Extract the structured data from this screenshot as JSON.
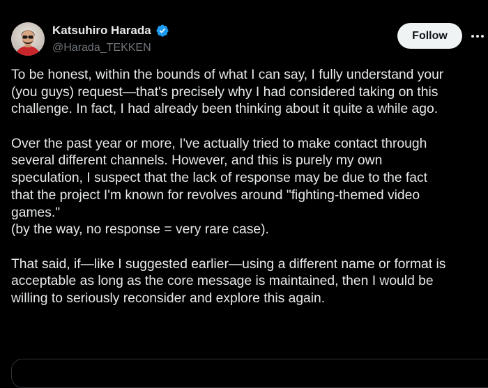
{
  "author": {
    "name": "Katsuhiro Harada",
    "handle": "@Harada_TEKKEN",
    "verified_icon": "verified-badge-icon",
    "verified_color": "#1d9bf0"
  },
  "actions": {
    "follow_label": "Follow",
    "more_icon": "more-options-icon"
  },
  "tweet": {
    "paragraphs": [
      [
        "To be honest, within the bounds of what I can say, I fully understand your",
        "(you guys) request—that's precisely why I had considered taking on this",
        "challenge. In fact, I had already been thinking about it quite a while ago."
      ],
      [
        "Over the past year or more, I've actually tried to make contact through",
        "several different channels. However, and this is purely my own",
        "speculation, I suspect that the lack of response may be due to the fact",
        "that the project I'm known for revolves around \"fighting-themed video",
        "games.\"",
        "(by the way, no response = very rare case)."
      ],
      [
        "That said, if—like I suggested earlier—using a different name or format is",
        "acceptable as long as the core message is maintained, then I would be",
        "willing to seriously reconsider and explore this again."
      ]
    ]
  },
  "colors": {
    "background": "#000000",
    "text": "#e7e9ea",
    "secondary_text": "#71767b",
    "follow_bg": "#eff3f4"
  }
}
